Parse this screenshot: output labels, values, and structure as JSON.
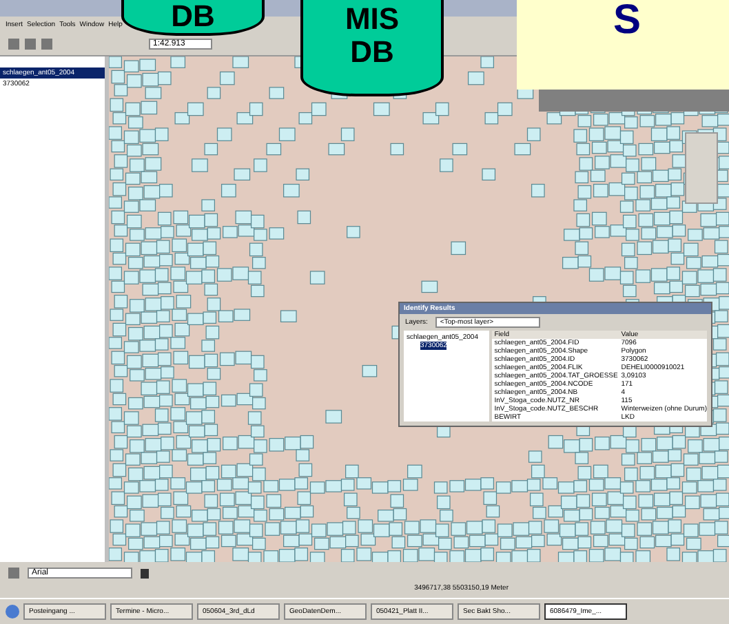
{
  "slide_shapes": [
    {
      "kind": "cylinder",
      "lines": [
        "DB"
      ]
    },
    {
      "kind": "cylinder",
      "lines": [
        "MIS",
        "DB"
      ]
    }
  ],
  "title_box": {
    "text": "S"
  },
  "menu": [
    "Insert",
    "Selection",
    "Tools",
    "Window",
    "Help"
  ],
  "scale": "1:42.913",
  "toc": [
    {
      "label": "schlaegen_ant05_2004",
      "selected": true
    },
    {
      "label": "3730062",
      "selected": false
    }
  ],
  "identify": {
    "title": "Identify Results",
    "layers_label": "Layers:",
    "layers_value": "<Top-most layer>",
    "tree_root": "schlaegen_ant05_2004",
    "tree_child": "3730062",
    "columns": [
      "Field",
      "Value"
    ],
    "rows": [
      {
        "field": "schlaegen_ant05_2004.FID",
        "value": "7096"
      },
      {
        "field": "schlaegen_ant05_2004.Shape",
        "value": "Polygon"
      },
      {
        "field": "schlaegen_ant05_2004.ID",
        "value": "3730062"
      },
      {
        "field": "schlaegen_ant05_2004.FLIK",
        "value": "DEHELI0000910021"
      },
      {
        "field": "schlaegen_ant05_2004.TAT_GROESSE",
        "value": "3,09103"
      },
      {
        "field": "schlaegen_ant05_2004.NCODE",
        "value": "171"
      },
      {
        "field": "schlaegen_ant05_2004.NB",
        "value": "4"
      },
      {
        "field": "InV_Stoga_code.NUTZ_NR",
        "value": "115"
      },
      {
        "field": "InV_Stoga_code.NUTZ_BESCHR",
        "value": "Winterweizen (ohne Durum)"
      },
      {
        "field": "BEWIRT",
        "value": "LKD"
      }
    ]
  },
  "font": "Arial",
  "status": "3496717,38  5503150,19 Meter",
  "taskbar": [
    {
      "label": "Posteingang ...",
      "selected": false
    },
    {
      "label": "Termine - Micro...",
      "selected": false
    },
    {
      "label": "050604_3rd_dLd",
      "selected": false
    },
    {
      "label": "GeoDatenDem...",
      "selected": false
    },
    {
      "label": "050421_Platt II...",
      "selected": false
    },
    {
      "label": "Sec Bakt Sho...",
      "selected": false
    },
    {
      "label": "6086479_Ime_...",
      "selected": true
    }
  ]
}
